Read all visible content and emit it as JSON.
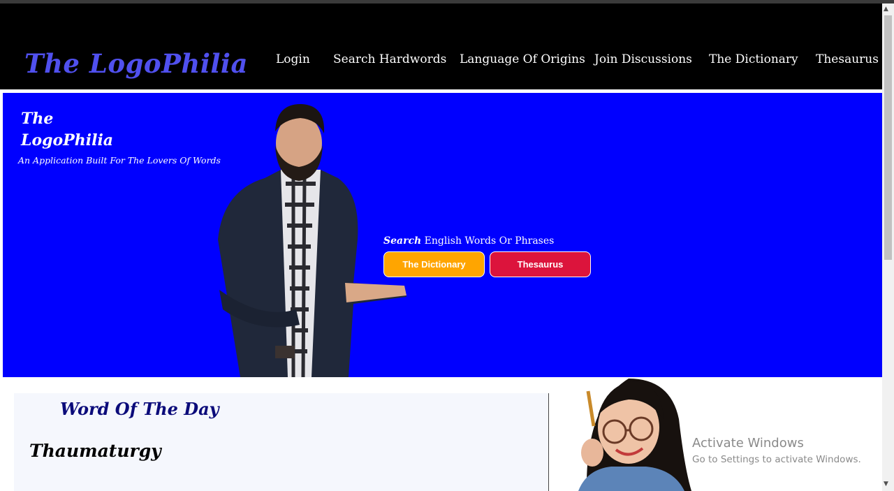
{
  "header": {
    "brand": "The LogoPhilia",
    "nav": [
      {
        "label": "Login"
      },
      {
        "label": "Search Hardwords"
      },
      {
        "label": "Language Of Origins"
      },
      {
        "label": "Join Discussions"
      },
      {
        "label": "The Dictionary"
      },
      {
        "label": "Thesaurus"
      }
    ]
  },
  "hero": {
    "title_line1": "The",
    "title_line2": "LogoPhilia",
    "tagline": "An Application Built For The Lovers Of Words",
    "search_emphasis": "Search",
    "search_rest": "English Words Or Phrases",
    "buttons": {
      "dictionary": "The Dictionary",
      "thesaurus": "Thesaurus"
    }
  },
  "word_of_the_day": {
    "heading": "Word Of The Day",
    "word": "Thaumaturgy"
  },
  "os_watermark": {
    "title": "Activate Windows",
    "subtitle": "Go to Settings to activate Windows."
  },
  "colors": {
    "nav_background": "#000000",
    "brand": "#5050ee",
    "hero_background": "#0000ff",
    "dictionary_button": "#ffa500",
    "thesaurus_button": "#dc143c",
    "wotd_heading": "#0b0b7a"
  }
}
